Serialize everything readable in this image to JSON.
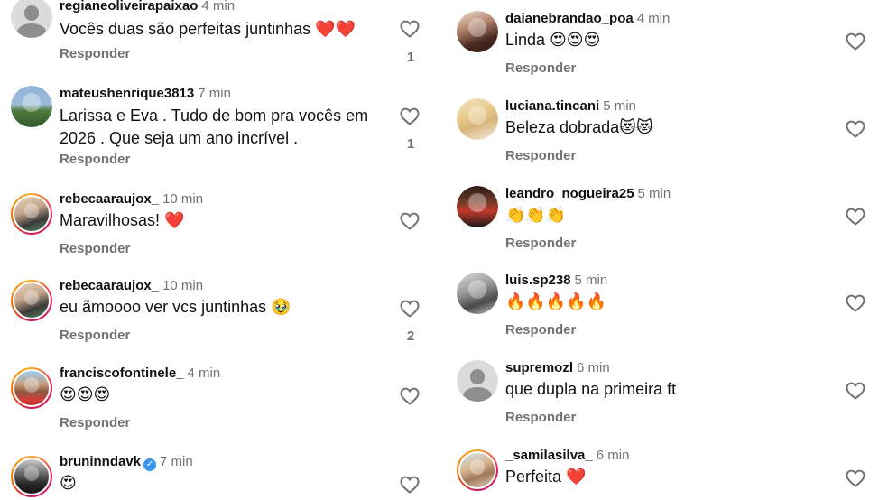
{
  "reply_label": "Responder",
  "left": [
    {
      "username": "regianeoliveirapaixao",
      "time": "4 min",
      "text": "Vocês duas são perfeitas juntinhas ❤️❤️",
      "likes": "1",
      "verified": false,
      "avatar": "default"
    },
    {
      "username": "mateushenrique3813",
      "time": "7 min",
      "text": "Larissa e Eva . Tudo de bom pra vocês em 2026 . Que seja um ano incrível .",
      "likes": "1",
      "verified": false,
      "avatar": "photo"
    },
    {
      "username": "rebecaaraujox_",
      "time": "10 min",
      "text": "Maravilhosas! ❤️",
      "likes": "",
      "verified": false,
      "avatar": "photo"
    },
    {
      "username": "rebecaaraujox_",
      "time": "10 min",
      "text": "eu ãmoooo ver vcs juntinhas 🥹",
      "likes": "2",
      "verified": false,
      "avatar": "photo"
    },
    {
      "username": "franciscofontinele_",
      "time": "4 min",
      "text": "😍😍😍",
      "likes": "",
      "verified": false,
      "avatar": "photo"
    },
    {
      "username": "bruninndavk",
      "time": "7 min",
      "text": "😍",
      "likes": "",
      "verified": true,
      "avatar": "photo"
    }
  ],
  "right": [
    {
      "username": "daianebrandao_poa",
      "time": "4 min",
      "text": "Linda 😍😍😍",
      "likes": "",
      "avatar": "photo"
    },
    {
      "username": "luciana.tincani",
      "time": "5 min",
      "text": "Beleza dobrada😻😻",
      "likes": "",
      "avatar": "photo"
    },
    {
      "username": "leandro_nogueira25",
      "time": "5 min",
      "text": "👏👏👏",
      "likes": "",
      "avatar": "photo"
    },
    {
      "username": "luis.sp238",
      "time": "5 min",
      "text": "🔥🔥🔥🔥🔥",
      "likes": "",
      "avatar": "photo"
    },
    {
      "username": "supremozl",
      "time": "6 min",
      "text": "que dupla na primeira ft",
      "likes": "",
      "avatar": "default"
    },
    {
      "username": "_samilasilva_",
      "time": "6 min",
      "text": "Perfeita ❤️",
      "likes": "",
      "avatar": "photo"
    }
  ],
  "colors": {
    "username": "#111111",
    "muted": "#737373",
    "verified": "#3797f0",
    "avatar_default": "#dbdbdb"
  },
  "icons": {
    "like": "heart-outline-icon",
    "verified": "verified-badge-icon"
  }
}
